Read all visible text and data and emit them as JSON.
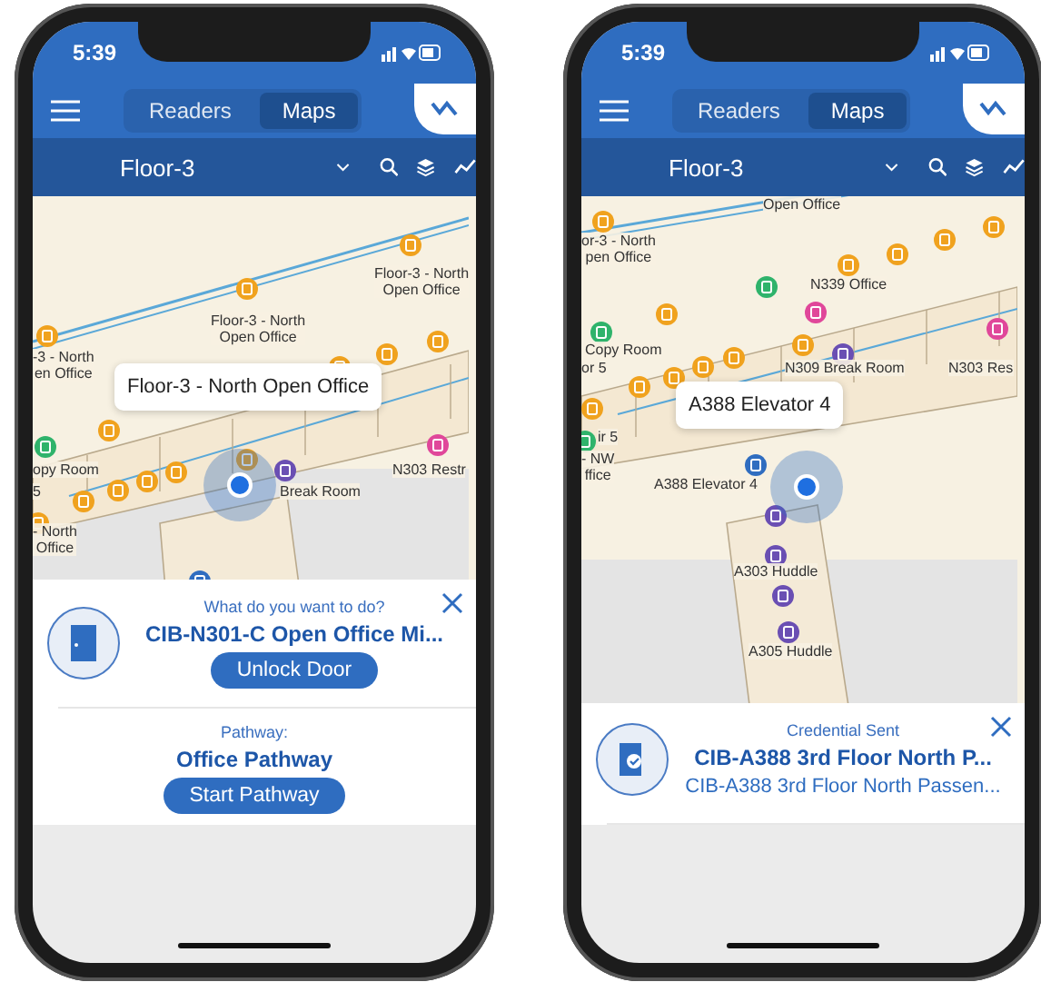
{
  "phones": [
    {
      "status_time": "5:39",
      "tabs": [
        {
          "label": "Readers",
          "selected": false
        },
        {
          "label": "Maps",
          "selected": true
        }
      ],
      "floor": "Floor-3",
      "map_labels": [
        "Floor-3 - North\nOpen Office",
        "Floor-3 - North\nOpen Office",
        "-3 - North\nen Office",
        "opy Room",
        "5",
        "N303 Restr",
        "Break Room",
        "- North\nOffice"
      ],
      "tooltip": "Floor-3 - North Open Office",
      "card": {
        "kind": "action",
        "prompt": "What do you want to do?",
        "title": "CIB-N301-C Open Office Mi...",
        "button": "Unlock Door",
        "pathway_label": "Pathway:",
        "pathway_name": "Office Pathway",
        "pathway_button": "Start Pathway"
      }
    },
    {
      "status_time": "5:39",
      "tabs": [
        {
          "label": "Readers",
          "selected": false
        },
        {
          "label": "Maps",
          "selected": true
        }
      ],
      "floor": "Floor-3",
      "map_labels": [
        "Open Office",
        "or-3 - North\npen Office",
        "N339 Office",
        "Copy Room",
        "or 5",
        "N309 Break Room",
        "N303 Res",
        "A388 Elevator 4",
        "ir 5",
        "- NW\nffice",
        "A303 Huddle",
        "A305 Huddle"
      ],
      "tooltip": "A388 Elevator 4",
      "card": {
        "kind": "sent",
        "status": "Credential Sent",
        "title": "CIB-A388 3rd Floor North P...",
        "subtitle": "CIB-A388 3rd Floor North Passen..."
      }
    }
  ]
}
